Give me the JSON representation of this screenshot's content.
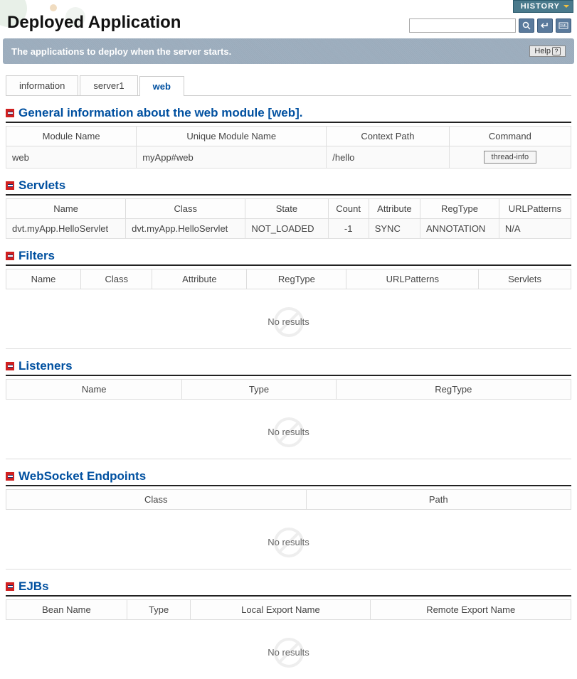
{
  "header": {
    "history_label": "HISTORY",
    "title": "Deployed Application",
    "search_placeholder": ""
  },
  "description": "The applications to deploy when the server starts.",
  "help_label": "Help",
  "tabs": [
    {
      "label": "information",
      "active": false
    },
    {
      "label": "server1",
      "active": false
    },
    {
      "label": "web",
      "active": true
    }
  ],
  "general": {
    "title": "General information about the web module [web].",
    "headers": [
      "Module Name",
      "Unique Module Name",
      "Context Path",
      "Command"
    ],
    "row": {
      "module_name": "web",
      "unique_name": "myApp#web",
      "context_path": "/hello",
      "command_label": "thread-info"
    }
  },
  "servlets": {
    "title": "Servlets",
    "headers": [
      "Name",
      "Class",
      "State",
      "Count",
      "Attribute",
      "RegType",
      "URLPatterns"
    ],
    "row": {
      "name": "dvt.myApp.HelloServlet",
      "class": "dvt.myApp.HelloServlet",
      "state": "NOT_LOADED",
      "count": "-1",
      "attribute": "SYNC",
      "regtype": "ANNOTATION",
      "urlpatterns": "N/A"
    }
  },
  "filters": {
    "title": "Filters",
    "headers": [
      "Name",
      "Class",
      "Attribute",
      "RegType",
      "URLPatterns",
      "Servlets"
    ],
    "no_results": "No results"
  },
  "listeners": {
    "title": "Listeners",
    "headers": [
      "Name",
      "Type",
      "RegType"
    ],
    "no_results": "No results"
  },
  "websocket": {
    "title": "WebSocket Endpoints",
    "headers": [
      "Class",
      "Path"
    ],
    "no_results": "No results"
  },
  "ejbs": {
    "title": "EJBs",
    "headers": [
      "Bean Name",
      "Type",
      "Local Export Name",
      "Remote Export Name"
    ],
    "no_results": "No results"
  }
}
